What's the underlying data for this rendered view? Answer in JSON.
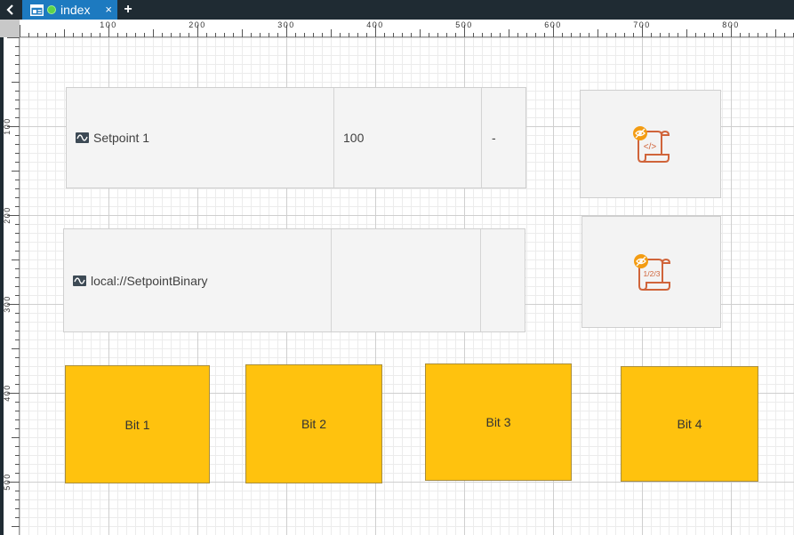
{
  "tabs": {
    "active": {
      "label": "index",
      "status_color": "#5dd44a"
    },
    "close_glyph": "×",
    "add_glyph": "+",
    "back_icon": "chevron-left-icon",
    "page_icon": "page-icon"
  },
  "rulers": {
    "top_labels": [
      "100",
      "200",
      "300",
      "400",
      "500",
      "600",
      "700",
      "800"
    ],
    "left_labels": [
      "100",
      "200",
      "300",
      "400",
      "500"
    ]
  },
  "widgets": {
    "setpoint1": {
      "label": "Setpoint 1",
      "value": "100",
      "unit": "-",
      "icon": "signal-wave-icon"
    },
    "setpoint_binary": {
      "label": "local://SetpointBinary",
      "value": "",
      "unit": "",
      "icon": "signal-wave-icon"
    },
    "script1": {
      "icon": "script-code-icon",
      "badge_icon": "hidden-eye-icon",
      "glyph": "</>"
    },
    "script2": {
      "icon": "script-sequence-icon",
      "badge_icon": "hidden-eye-icon",
      "glyph": "1/2/3"
    }
  },
  "bits": [
    {
      "label": "Bit 1"
    },
    {
      "label": "Bit 2"
    },
    {
      "label": "Bit 3"
    },
    {
      "label": "Bit 4"
    }
  ],
  "colors": {
    "bit_fill": "#ffc20e",
    "tab_active": "#1d7ac0",
    "tab_bar": "#1f2b33",
    "script_icon": "#d0643a",
    "badge": "#f39c12"
  }
}
